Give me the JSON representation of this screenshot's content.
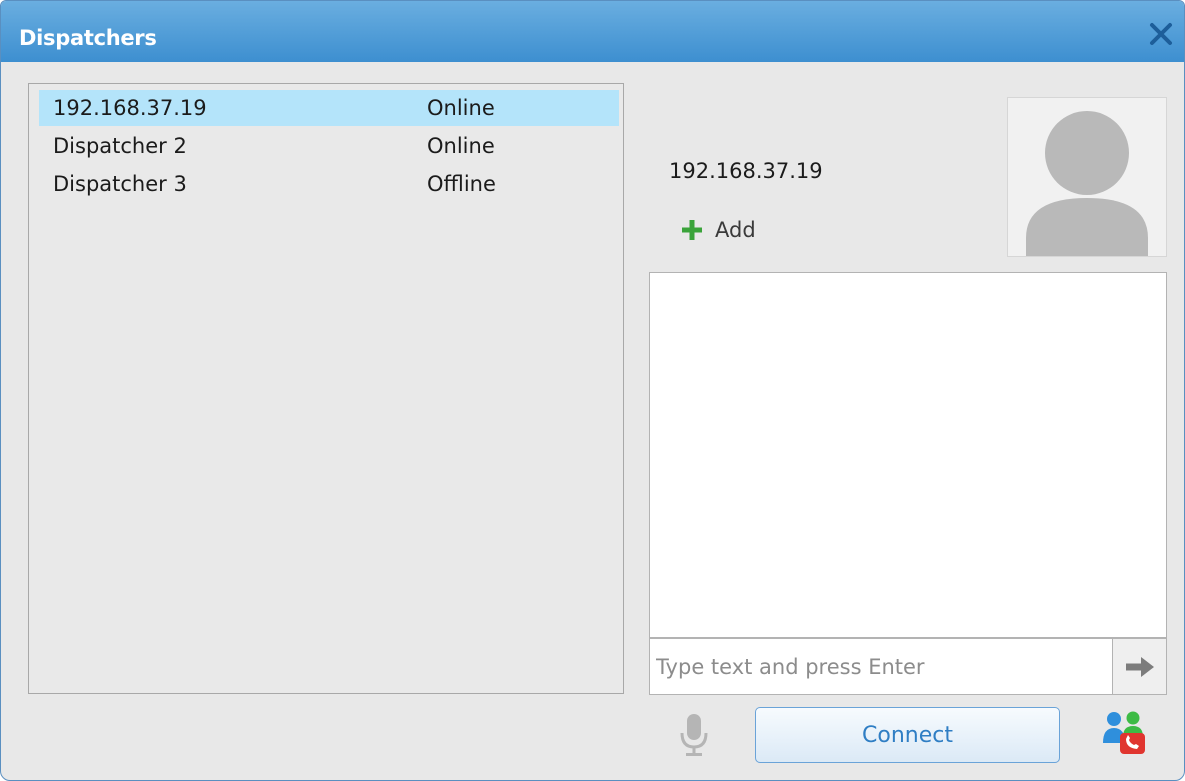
{
  "window": {
    "title": "Dispatchers"
  },
  "dispatchers": [
    {
      "name": "192.168.37.19",
      "status": "Online",
      "selected": true
    },
    {
      "name": "Dispatcher 2",
      "status": "Online",
      "selected": false
    },
    {
      "name": "Dispatcher 3",
      "status": "Offline",
      "selected": false
    }
  ],
  "contact": {
    "name": "192.168.37.19",
    "add_label": "Add"
  },
  "chat": {
    "input_placeholder": "Type text and press Enter"
  },
  "actions": {
    "connect_label": "Connect"
  },
  "icons": {
    "close": "close-icon",
    "add": "plus-icon",
    "avatar": "user-avatar-icon",
    "send": "arrow-right-icon",
    "mic": "microphone-icon",
    "call": "group-call-icon"
  },
  "colors": {
    "titlebar": "#4a98d6",
    "selection": "#b4e4fa",
    "add_plus": "#3aa33a",
    "connect_text": "#2f7ec4",
    "call_red": "#e0352f"
  }
}
